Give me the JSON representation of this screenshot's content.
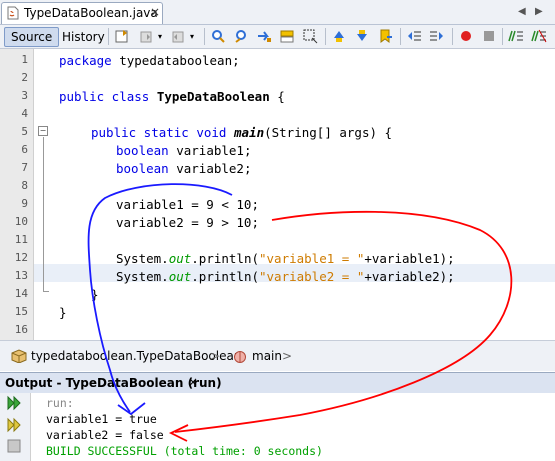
{
  "editor_tab": {
    "filename": "TypeDataBoolean.java",
    "close_glyph": "×"
  },
  "tab_nav": {
    "left": "◀",
    "right": "▶"
  },
  "toolbar": {
    "source_label": "Source",
    "history_label": "History"
  },
  "gutter": {
    "line_numbers": [
      "1",
      "2",
      "3",
      "4",
      "5",
      "6",
      "7",
      "8",
      "9",
      "10",
      "11",
      "12",
      "13",
      "14",
      "15",
      "16"
    ]
  },
  "code": {
    "l1_kw": "package",
    "l1_rest": " typedataboolean;",
    "l3_kw": "public class",
    "l3_name": "TypeDataBoolean",
    "l3_rest": " {",
    "l5_kw": "public static void",
    "l5_method": "main",
    "l5_rest": "(String[] args) {",
    "l6_kw": "boolean",
    "l6_rest": " variable1;",
    "l7_kw": "boolean",
    "l7_rest": " variable2;",
    "l9": "variable1 = 9 < 10;",
    "l10": "variable2 = 9 > 10;",
    "l12_a": "System.",
    "l12_out": "out",
    "l12_b": ".println(",
    "l12_str": "\"variable1 = \"",
    "l12_c": "+variable1);",
    "l13_a": "System.",
    "l13_out": "out",
    "l13_b": ".println(",
    "l13_str": "\"variable2 = \"",
    "l13_c": "+variable2);",
    "l14": "}",
    "l15": "}"
  },
  "breadcrumb": {
    "class_path": "typedataboolean.TypeDataBoolean",
    "method": "main"
  },
  "output": {
    "title": "Output - TypeDataBoolean (run)",
    "close_glyph": "×",
    "lines": [
      "run:",
      "variable1 = true",
      "variable2 = false",
      "BUILD SUCCESSFUL (total time: 0 seconds)"
    ]
  },
  "colors": {
    "keyword": "#0000e6",
    "string": "#ce7b00",
    "field": "#009900",
    "annotation_blue": "#1a1aff",
    "annotation_red": "#ff0000"
  },
  "icons": [
    "java-file-icon",
    "back-icon",
    "forward-icon",
    "find-prev-icon",
    "find-next-icon",
    "toggle-highlight-icon",
    "toggle-bookmark-icon",
    "prev-bookmark-icon",
    "next-bookmark-icon",
    "shift-left-icon",
    "shift-right-icon",
    "record-macro-icon",
    "stop-macro-icon",
    "comment-icon",
    "uncomment-icon",
    "package-icon",
    "method-icon",
    "rerun-icon",
    "stop-run-icon"
  ]
}
